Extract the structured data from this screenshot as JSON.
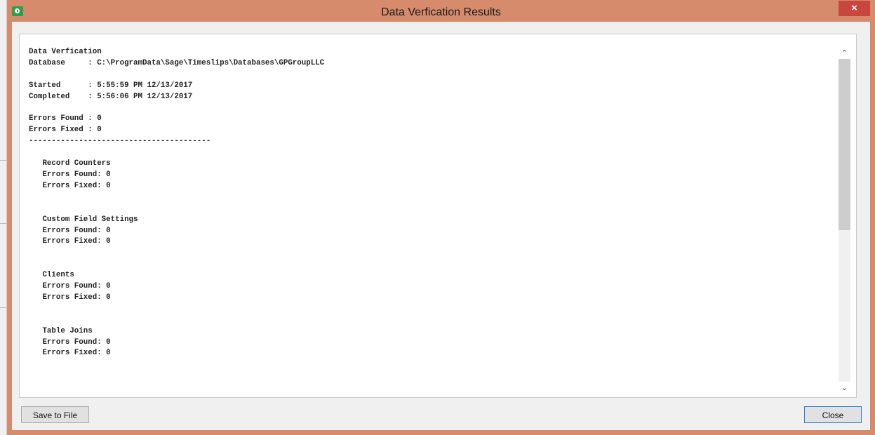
{
  "window": {
    "title": "Data Verfication Results",
    "close_glyph": "×",
    "accent_color": "#d68b6c",
    "close_color": "#c7463d"
  },
  "report": {
    "lines": [
      "Data Verfication",
      "Database     : C:\\ProgramData\\Sage\\Timeslips\\Databases\\GPGroupLLC",
      "",
      "Started      : 5:55:59 PM 12/13/2017",
      "Completed    : 5:56:06 PM 12/13/2017",
      "",
      "Errors Found : 0",
      "Errors Fixed : 0",
      "----------------------------------------",
      "",
      "   Record Counters",
      "   Errors Found: 0",
      "   Errors Fixed: 0",
      "",
      "",
      "   Custom Field Settings",
      "   Errors Found: 0",
      "   Errors Fixed: 0",
      "",
      "",
      "   Clients",
      "   Errors Found: 0",
      "   Errors Fixed: 0",
      "",
      "",
      "   Table Joins",
      "   Errors Found: 0",
      "   Errors Fixed: 0"
    ]
  },
  "scrollbar": {
    "up_glyph": "⌃",
    "down_glyph": "⌄"
  },
  "buttons": {
    "save_label": "Save to File",
    "close_label": "Close"
  },
  "icons": {
    "app": "timeslips-app-icon",
    "close": "close-icon",
    "scroll_up": "chevron-up-icon",
    "scroll_down": "chevron-down-icon"
  }
}
